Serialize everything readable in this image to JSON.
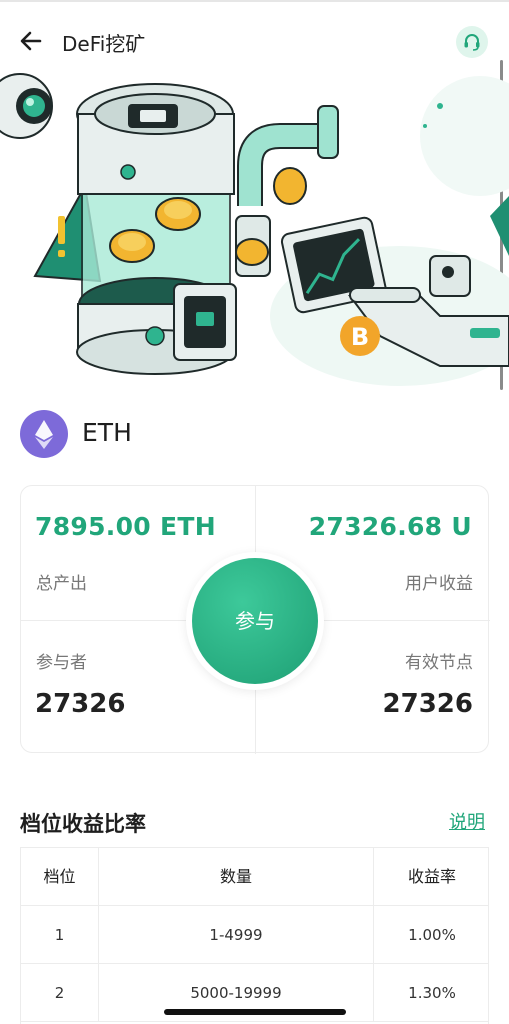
{
  "header": {
    "title": "DeFi挖矿"
  },
  "coin": {
    "name": "ETH"
  },
  "stats": {
    "total_output_value": "7895.00 ETH",
    "total_output_label": "总产出",
    "user_earnings_value": "27326.68 U",
    "user_earnings_label": "用户收益",
    "participants_label": "参与者",
    "participants_value": "27326",
    "valid_nodes_label": "有效节点",
    "valid_nodes_value": "27326"
  },
  "join_button": "参与",
  "tier_section": {
    "title": "档位收益比率",
    "explain_link": "说明",
    "columns": [
      "档位",
      "数量",
      "收益率"
    ],
    "rows": [
      [
        "1",
        "1-4999",
        "1.00%"
      ],
      [
        "2",
        "5000-19999",
        "1.30%"
      ]
    ]
  },
  "colors": {
    "accent": "#21a67a",
    "eth_purple": "#7d6ad9",
    "coin_gold": "#f2b530"
  },
  "icons": [
    "back-arrow-icon",
    "headset-icon",
    "ethereum-icon",
    "bitcoin-icon"
  ]
}
